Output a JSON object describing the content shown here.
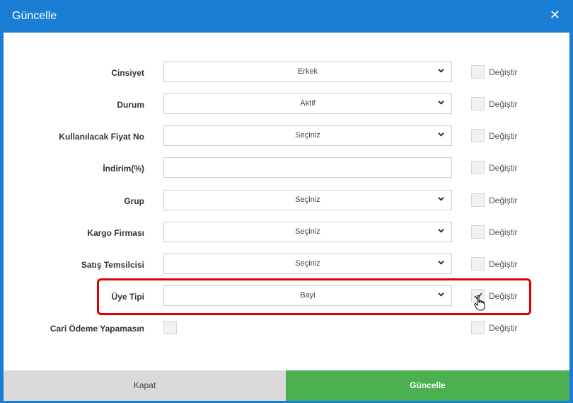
{
  "modal": {
    "title": "Güncelle",
    "close_symbol": "✕",
    "change_label": "Değiştir",
    "fields": [
      {
        "label": "Cinsiyet",
        "type": "select",
        "value": "Erkek",
        "change_checked": false
      },
      {
        "label": "Durum",
        "type": "select",
        "value": "Aktif",
        "change_checked": false
      },
      {
        "label": "Kullanılacak Fiyat No",
        "type": "select",
        "value": "Seçiniz",
        "change_checked": false
      },
      {
        "label": "İndirim(%)",
        "type": "text",
        "value": "",
        "change_checked": false
      },
      {
        "label": "Grup",
        "type": "select",
        "value": "Seçiniz",
        "change_checked": false
      },
      {
        "label": "Kargo Firması",
        "type": "select",
        "value": "Seçiniz",
        "change_checked": false
      },
      {
        "label": "Satış Temsilcisi",
        "type": "select",
        "value": "Seçiniz",
        "change_checked": false
      },
      {
        "label": "Üye Tipi",
        "type": "select",
        "value": "Bayi",
        "change_checked": true
      },
      {
        "label": "Cari Ödeme Yapamasın",
        "type": "checkbox",
        "value": false,
        "change_checked": false
      }
    ],
    "footer": {
      "close_label": "Kapat",
      "update_label": "Güncelle"
    }
  },
  "colors": {
    "header": "#1a7fd4",
    "update_button": "#4caf50",
    "close_button": "#dadada",
    "highlight": "#e00000"
  }
}
